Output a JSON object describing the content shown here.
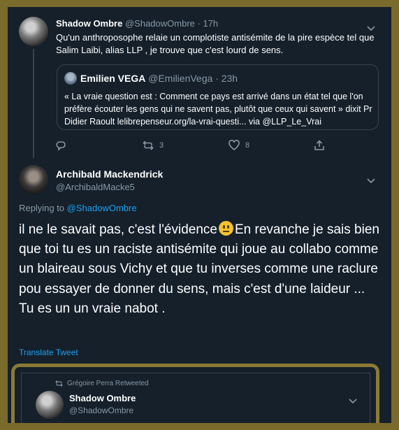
{
  "tweet1": {
    "name": "Shadow Ombre",
    "handle": "@ShadowOmbre",
    "time": "· 17h",
    "text": "Qu'un anthroposophe relaie un complotiste antisémite de la pire espèce tel que Salim Laibi, alias LLP , je trouve que c'est lourd de sens.",
    "quote": {
      "name": "Emilien VEGA",
      "handle": "@EmilienVega",
      "time": "· 23h",
      "text": "« La vraie question est : Comment ce pays est arrivé dans un état tel que l'on préfère écouter les gens qui ne savent pas, plutôt que ceux qui savent » dixit Pr Didier Raoult lelibrepenseur.org/la-vrai-questi... via @LLP_Le_Vrai"
    },
    "actions": {
      "retweets": "3",
      "likes": "8"
    }
  },
  "tweet2": {
    "name": "Archibald Mackendrick",
    "handle": "@ArchibaldMacke5",
    "replying_label": "Replying to",
    "replying_to": "@ShadowOmbre",
    "text_before_emoji": "il ne le savait pas, c'est l'évidence",
    "text_after_emoji": "En revanche je sais bien que toi tu es un raciste antisémite qui joue au collabo comme  un blaireau sous Vichy et que tu inverses comme une raclure pou essayer de donner du sens, mais c'est d'une laideur ... Tu es un  un vraie nabot .",
    "translate": "Translate Tweet"
  },
  "embedded": {
    "retweeted_by": "Grégoire Perra Retweeted",
    "name": "Shadow Ombre",
    "handle": "@ShadowOmbre"
  },
  "icons": {
    "reply": "reply-icon",
    "retweet": "retweet-icon",
    "like": "heart-icon",
    "share": "share-icon",
    "more": "chevron-down-icon"
  },
  "colors": {
    "background": "#15202b",
    "link": "#1da1f2",
    "muted": "#8899a6",
    "frame": "#7a6a2c"
  }
}
